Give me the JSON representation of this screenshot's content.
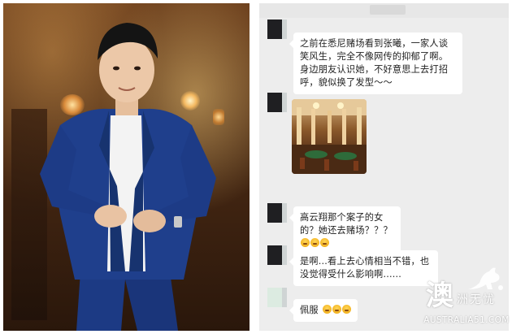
{
  "photo": {
    "alt_subject": "man in blue suit"
  },
  "chat": {
    "messages": [
      {
        "type": "text",
        "text": "之前在悉尼赌场看到张曦，一家人谈笑风生，完全不像网传的抑郁了啊。身边朋友认识她，不好意思上去打招呼，貌似换了发型～～"
      },
      {
        "type": "image"
      },
      {
        "type": "text",
        "text": "高云翔那个案子的女的？她还去赌场？？？",
        "emoji_count": 3
      },
      {
        "type": "text",
        "text": "是啊...看上去心情相当不错，也没觉得受什么影响啊......"
      },
      {
        "type": "text",
        "text": "佩服",
        "emoji_count": 3
      }
    ]
  },
  "watermark": {
    "big_char": "澳",
    "small_text": "洲无忧",
    "url": "AUSTRALIA51.COM"
  },
  "colors": {
    "chat_bg": "#ededed",
    "bubble_bg": "#ffffff",
    "suit_blue": "#1f3f8c"
  }
}
